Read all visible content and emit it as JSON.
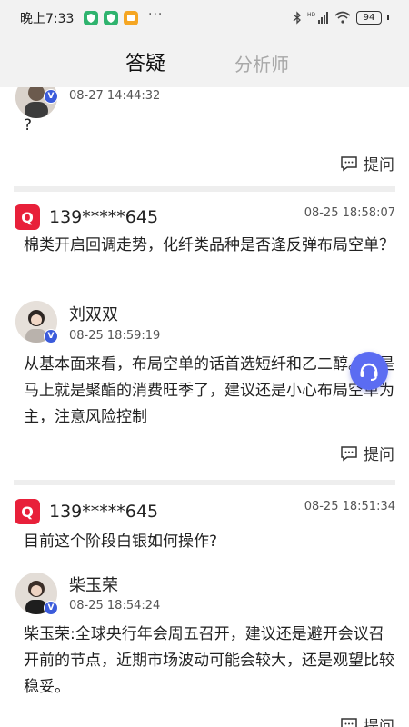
{
  "status_bar": {
    "time": "晚上7:33",
    "battery": "94",
    "app_icons": [
      "shield-green-icon",
      "shield-green-icon",
      "message-orange-icon"
    ],
    "colors": {
      "green": "#2fb36e",
      "orange": "#f5a623"
    }
  },
  "header": {
    "tabs": [
      {
        "label": "答疑",
        "active": true
      },
      {
        "label": "分析师",
        "active": false
      }
    ]
  },
  "posts": [
    {
      "answer": {
        "time": "08-27 14:44:32",
        "text": "?"
      },
      "ask_label": "提问"
    },
    {
      "user": "139*****645",
      "time": "08-25 18:58:07",
      "question": "棉类开启回调走势，化纤类品种是否逢反弹布局空单？",
      "answer": {
        "name": "刘双双",
        "time": "08-25 18:59:19",
        "text": "从基本面来看，布局空单的话首选短纤和乙二醇。但是马上就是聚酯的消费旺季了，建议还是小心布局空单为主，注意风险控制"
      },
      "ask_label": "提问"
    },
    {
      "user": "139*****645",
      "time": "08-25 18:51:34",
      "question": "目前这个阶段白银如何操作?",
      "answer": {
        "name": "柴玉荣",
        "time": "08-25 18:54:24",
        "text": "柴玉荣:全球央行年会周五召开，建议还是避开会议召开前的节点，近期市场波动可能会较大，还是观望比较稳妥。"
      },
      "ask_label": "提问"
    }
  ],
  "floating_button": {
    "icon": "customer-service-icon",
    "color": "#5b6cf2"
  },
  "colors": {
    "brand_red": "#e8203a",
    "verify_blue": "#3b5bdb"
  }
}
